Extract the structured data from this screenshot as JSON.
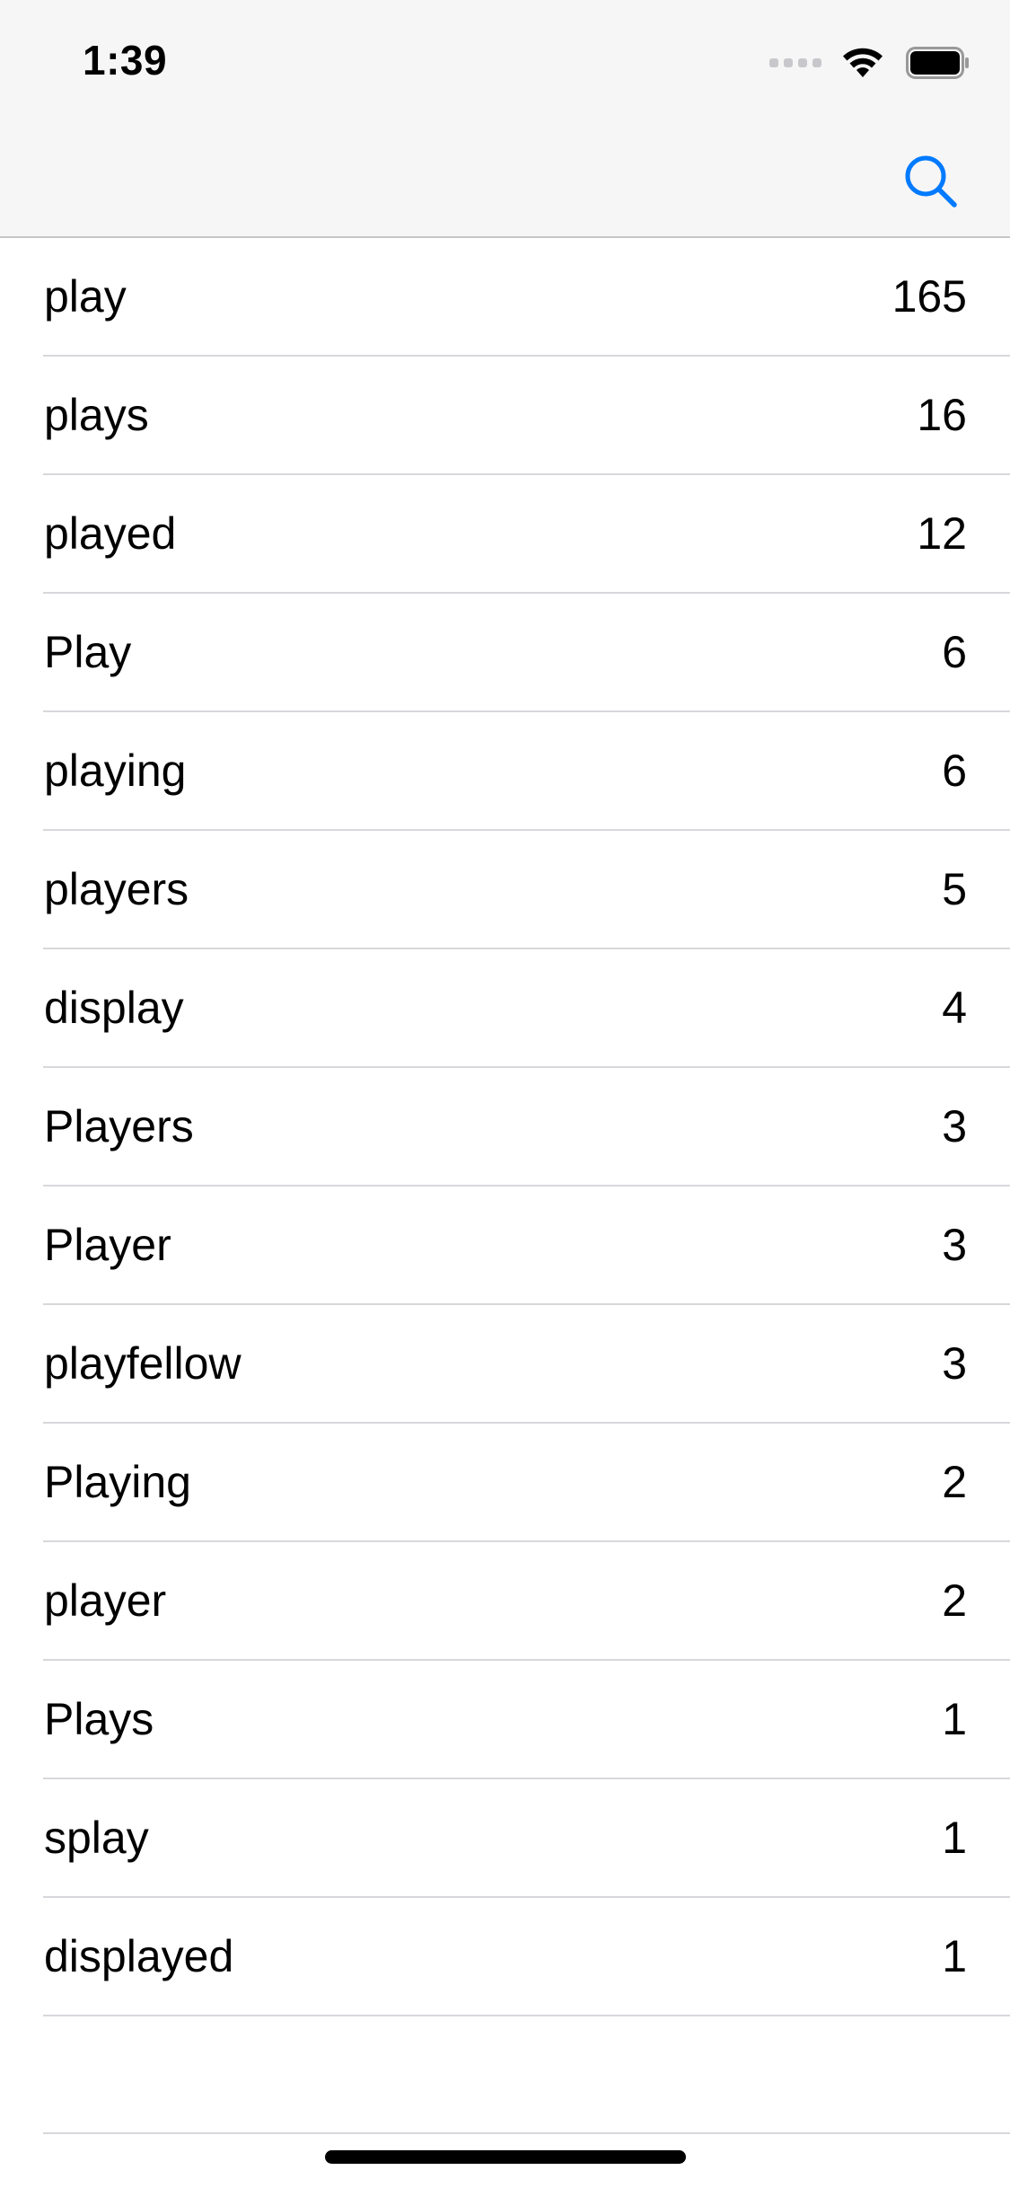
{
  "status_bar": {
    "time": "1:39"
  },
  "nav_bar": {
    "search_icon": "magnifying-glass-icon",
    "accent_color": "#007aff"
  },
  "words": [
    {
      "word": "play",
      "count": "165"
    },
    {
      "word": "plays",
      "count": "16"
    },
    {
      "word": "played",
      "count": "12"
    },
    {
      "word": "Play",
      "count": "6"
    },
    {
      "word": "playing",
      "count": "6"
    },
    {
      "word": "players",
      "count": "5"
    },
    {
      "word": "display",
      "count": "4"
    },
    {
      "word": "Players",
      "count": "3"
    },
    {
      "word": "Player",
      "count": "3"
    },
    {
      "word": "playfellow",
      "count": "3"
    },
    {
      "word": "Playing",
      "count": "2"
    },
    {
      "word": "player",
      "count": "2"
    },
    {
      "word": "Plays",
      "count": "1"
    },
    {
      "word": "splay",
      "count": "1"
    },
    {
      "word": "displayed",
      "count": "1"
    }
  ]
}
